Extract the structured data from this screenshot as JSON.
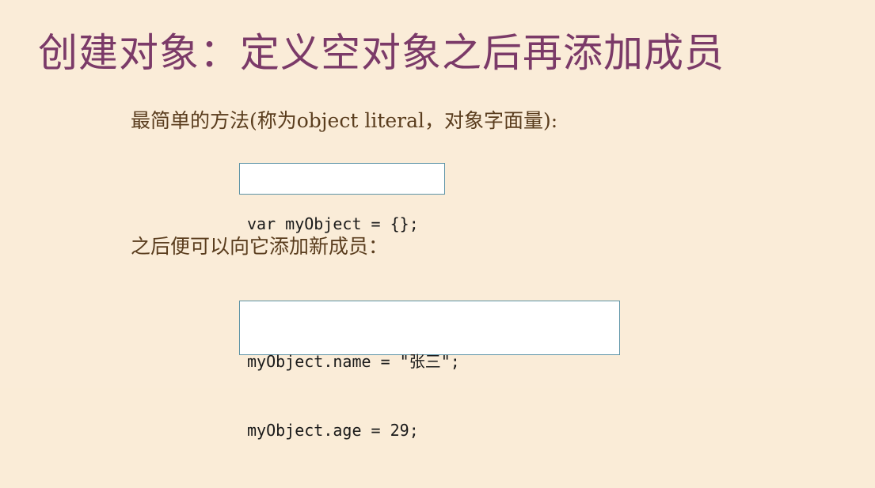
{
  "slide": {
    "title": "创建对象：定义空对象之后再添加成员",
    "paragraph_1": "最简单的方法(称为object literal，对象字面量):",
    "code_block_1": [
      "var myObject = {};"
    ],
    "paragraph_2": "之后便可以向它添加新成员：",
    "code_block_2": [
      "myObject.name = \"张三\";",
      "myObject.age = 29;"
    ]
  },
  "colors": {
    "background": "#faecd8",
    "title": "#7b3a68",
    "body_text": "#5a3d1e",
    "code_border": "#5c93a6"
  }
}
